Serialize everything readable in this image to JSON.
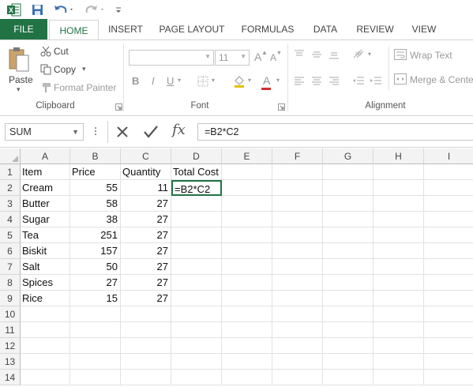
{
  "app": {
    "quick_access": [
      "excel-logo",
      "save",
      "undo",
      "redo",
      "customize"
    ]
  },
  "tabs": [
    {
      "label": "FILE"
    },
    {
      "label": "HOME"
    },
    {
      "label": "INSERT"
    },
    {
      "label": "PAGE LAYOUT"
    },
    {
      "label": "FORMULAS"
    },
    {
      "label": "DATA"
    },
    {
      "label": "REVIEW"
    },
    {
      "label": "VIEW"
    }
  ],
  "ribbon": {
    "clipboard": {
      "paste": "Paste",
      "cut": "Cut",
      "copy": "Copy",
      "format_painter": "Format Painter",
      "label": "Clipboard"
    },
    "font": {
      "font_size": "11",
      "bold": "B",
      "italic": "I",
      "underline": "U",
      "grow": "A",
      "shrink": "A",
      "font_color": "A",
      "label": "Font"
    },
    "alignment": {
      "wrap_text": "Wrap Text",
      "merge_center": "Merge & Cente",
      "label": "Alignment"
    }
  },
  "formula_bar": {
    "name_box": "SUM",
    "fx": "fx",
    "formula": "=B2*C2"
  },
  "sheet": {
    "columns": [
      "A",
      "B",
      "C",
      "D",
      "E",
      "F",
      "G",
      "H",
      "I"
    ],
    "rows": [
      "1",
      "2",
      "3",
      "4",
      "5",
      "6",
      "7",
      "8",
      "9",
      "10",
      "11",
      "12",
      "13",
      "14"
    ],
    "headers": [
      "Item",
      "Price",
      "Quantity",
      "Total Cost"
    ],
    "data": [
      {
        "item": "Cream",
        "price": "55",
        "qty": "11",
        "total": "=B2*C2"
      },
      {
        "item": "Butter",
        "price": "58",
        "qty": "27",
        "total": ""
      },
      {
        "item": "Sugar",
        "price": "38",
        "qty": "27",
        "total": ""
      },
      {
        "item": "Tea",
        "price": "251",
        "qty": "27",
        "total": ""
      },
      {
        "item": "Biskit",
        "price": "157",
        "qty": "27",
        "total": ""
      },
      {
        "item": "Salt",
        "price": "50",
        "qty": "27",
        "total": ""
      },
      {
        "item": "Spices",
        "price": "27",
        "qty": "27",
        "total": ""
      },
      {
        "item": "Rice",
        "price": "15",
        "qty": "27",
        "total": ""
      }
    ]
  },
  "colors": {
    "excel_green": "#217346",
    "header_bg": "#f3f3f3",
    "gridline": "#e2e2e2"
  }
}
